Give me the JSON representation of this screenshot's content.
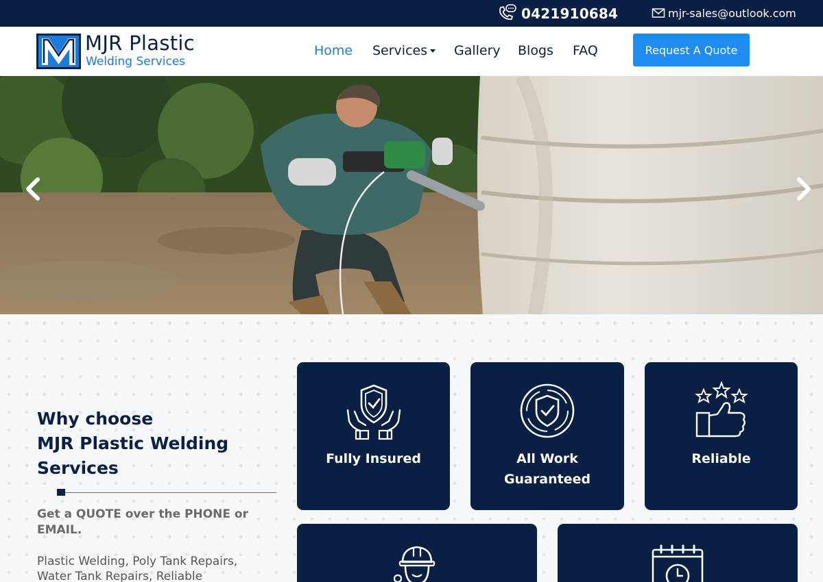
{
  "topbar": {
    "phone": "0421910684",
    "email": "mjr-sales@outlook.com",
    "phone_icon": "phone-icon",
    "email_icon": "envelope-icon"
  },
  "header": {
    "logo_letter": "M",
    "logo_name": "MJR Plastic",
    "logo_sub": "Welding Services",
    "nav": {
      "home": "Home",
      "services": "Services",
      "gallery": "Gallery",
      "blogs": "Blogs",
      "faq": "FAQ"
    },
    "quote_button": "Request A Quote",
    "colors": {
      "navy": "#0a1f44",
      "accent": "#1a7bd8",
      "button": "#1e8cf0"
    }
  },
  "hero": {
    "prev_icon": "chevron-left-icon",
    "next_icon": "chevron-right-icon"
  },
  "why": {
    "title_line1": "Why choose",
    "title_line2": "MJR Plastic Welding",
    "title_line3": "Services",
    "quote_text": "Get a QUOTE over the PHONE or EMAIL.",
    "desc_line1": "Plastic Welding, Poly Tank Repairs,",
    "desc_line2": "Water Tank Repairs, Reliable",
    "cards": [
      {
        "label_line1": "Fully Insured",
        "label_line2": "",
        "icon": "shield-hands-icon"
      },
      {
        "label_line1": "All Work",
        "label_line2": "Guaranteed",
        "icon": "guarantee-badge-icon"
      },
      {
        "label_line1": "Reliable",
        "label_line2": "",
        "icon": "thumbs-up-stars-icon"
      },
      {
        "label_line1": "",
        "label_line2": "",
        "icon": "worker-icon"
      },
      {
        "label_line1": "",
        "label_line2": "",
        "icon": "calendar-clock-icon"
      }
    ]
  }
}
